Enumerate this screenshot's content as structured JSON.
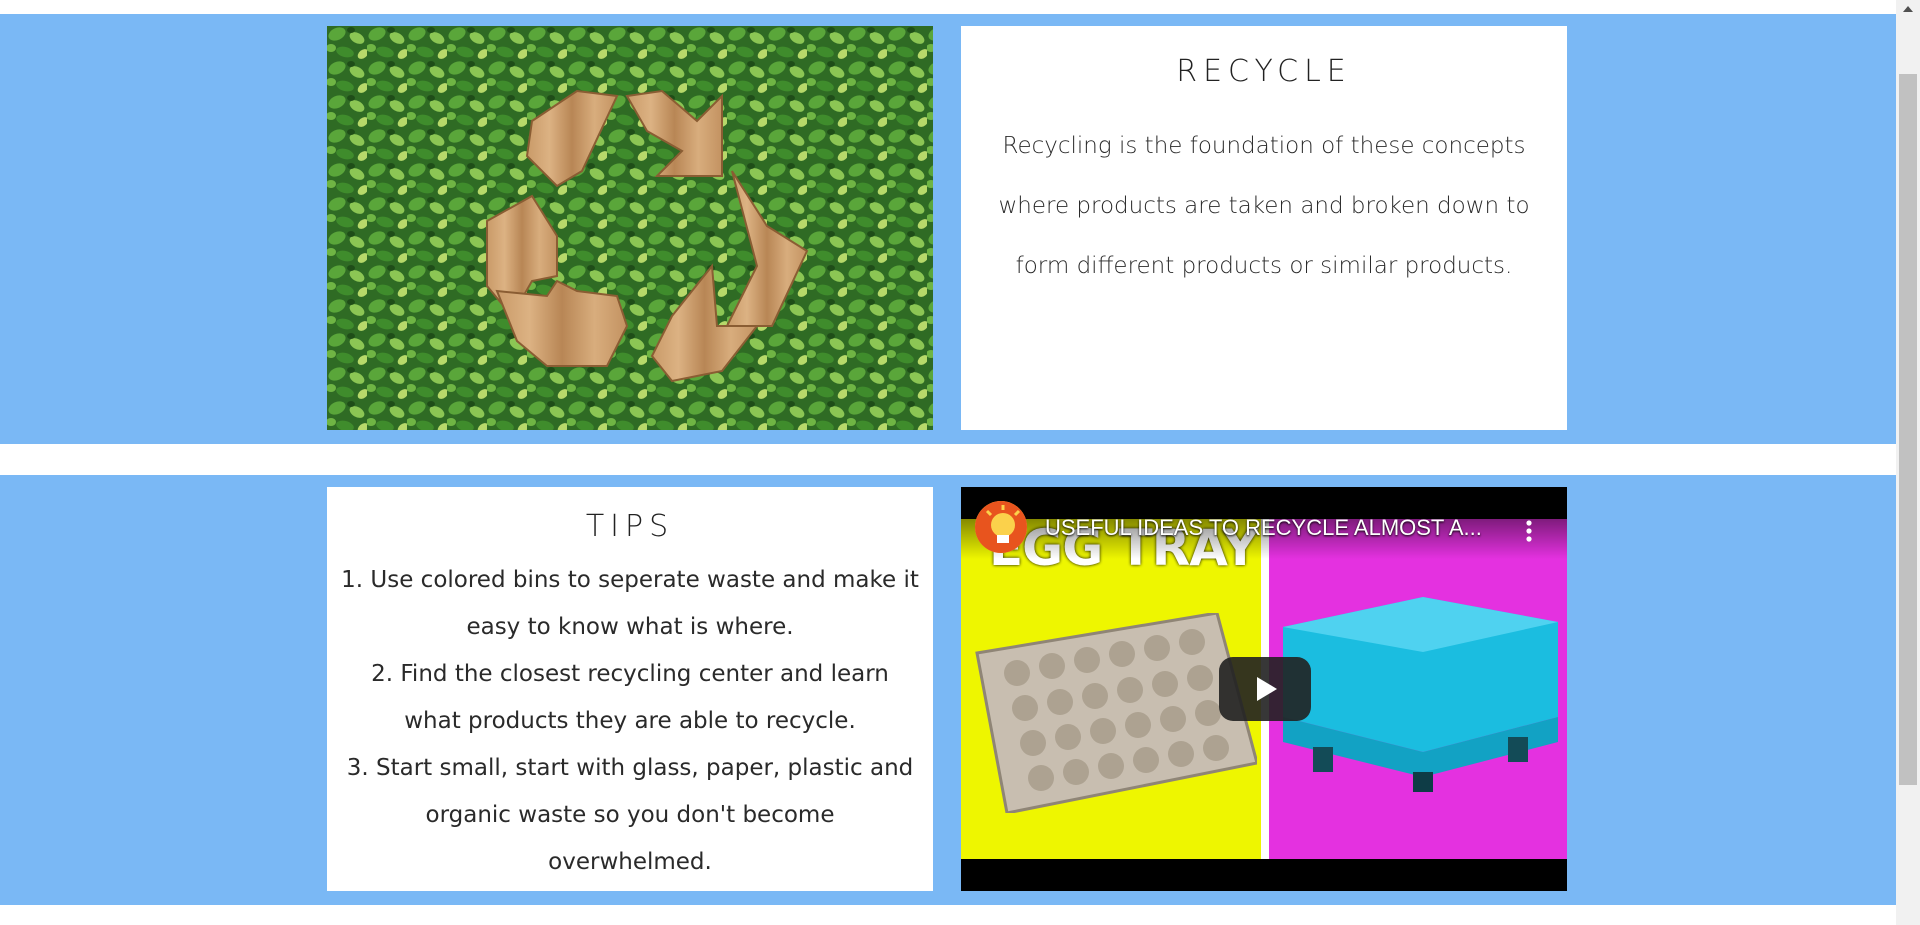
{
  "recycle": {
    "heading": "RECYCLE",
    "body": "Recycling is the foundation of these concepts where products are taken and broken down to form different products or similar products.",
    "image_icon": "recycle-symbol-on-leaves"
  },
  "tips": {
    "heading": "TIPS",
    "items": [
      "1. Use colored bins to seperate waste and make it easy to know what is where.",
      "2. Find the closest recycling center and learn what products they are able to recycle.",
      "3. Start small, start with glass, paper, plastic and organic waste so you don't become overwhelmed."
    ]
  },
  "video": {
    "title": "USEFUL IDEAS TO RECYCLE ALMOST A...",
    "thumbnail_text": "EGG TRAY",
    "play_icon": "play-icon",
    "menu_icon": "more-vert-icon",
    "colors": {
      "left_panel": "#eef600",
      "right_panel": "#e431e0",
      "ottoman": "#1bbde0"
    }
  },
  "theme": {
    "band_color": "#7ab8f5",
    "card_color": "#ffffff"
  }
}
